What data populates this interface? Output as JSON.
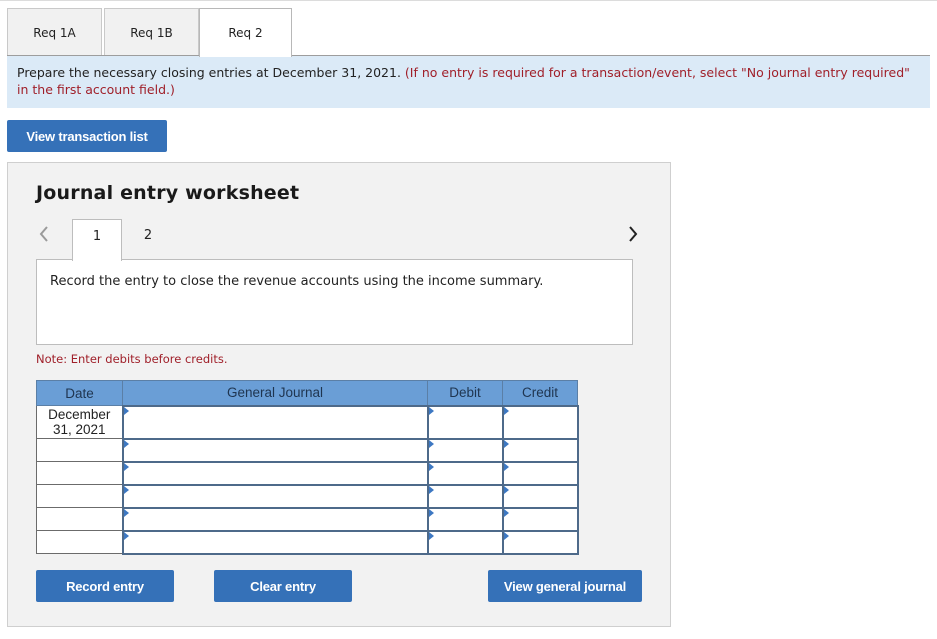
{
  "tabs": [
    {
      "label": "Req 1A",
      "active": false
    },
    {
      "label": "Req 1B",
      "active": false
    },
    {
      "label": "Req 2",
      "active": true
    }
  ],
  "instructions": {
    "main": "Prepare the necessary closing entries at December 31, 2021.",
    "note": "(If no entry is required for a transaction/event, select \"No journal entry required\" in the first account field.)"
  },
  "view_transaction_list_label": "View transaction list",
  "worksheet": {
    "title": "Journal entry worksheet",
    "prev_icon": "chevron-left-icon",
    "next_icon": "chevron-right-icon",
    "pages": [
      {
        "label": "1",
        "active": true
      },
      {
        "label": "2",
        "active": false
      }
    ],
    "description": "Record the entry to close the revenue accounts using the income summary.",
    "note": "Note: Enter debits before credits.",
    "table": {
      "headers": {
        "date": "Date",
        "journal": "General Journal",
        "debit": "Debit",
        "credit": "Credit"
      },
      "rows": [
        {
          "date": "December 31, 2021",
          "account": "",
          "debit": "",
          "credit": ""
        },
        {
          "date": "",
          "account": "",
          "debit": "",
          "credit": ""
        },
        {
          "date": "",
          "account": "",
          "debit": "",
          "credit": ""
        },
        {
          "date": "",
          "account": "",
          "debit": "",
          "credit": ""
        },
        {
          "date": "",
          "account": "",
          "debit": "",
          "credit": ""
        },
        {
          "date": "",
          "account": "",
          "debit": "",
          "credit": ""
        }
      ]
    },
    "buttons": {
      "record": "Record entry",
      "clear": "Clear entry",
      "view_journal": "View general journal"
    }
  }
}
